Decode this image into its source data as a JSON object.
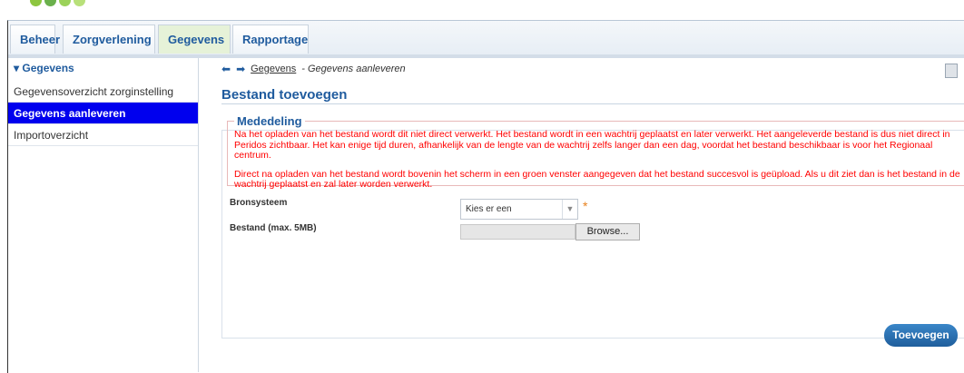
{
  "tabs": [
    {
      "label": "Beheer",
      "active": false
    },
    {
      "label": "Zorgverlening",
      "active": false
    },
    {
      "label": "Gegevens",
      "active": true
    },
    {
      "label": "Rapportage",
      "active": false
    }
  ],
  "sidebar": {
    "header": "Gegevens",
    "header_icon": "triangle-down",
    "items": [
      {
        "label": "Gegevensoverzicht zorginstelling",
        "active": false
      },
      {
        "label": "Gegevens aanleveren",
        "active": true
      },
      {
        "label": "Importoverzicht",
        "active": false
      }
    ]
  },
  "breadcrumb": {
    "link": "Gegevens",
    "current": "- Gegevens aanleveren",
    "icons": [
      "arrow-left-icon",
      "arrow-right-icon"
    ]
  },
  "page": {
    "title": "Bestand toevoegen"
  },
  "notice": {
    "legend": "Mededeling",
    "paragraph1": "Na het opladen van het bestand wordt dit niet direct verwerkt. Het bestand wordt in een wachtrij geplaatst en later verwerkt. Het aangeleverde bestand is dus niet direct in Peridos zichtbaar. Het kan enige tijd duren, afhankelijk van de lengte van de wachtrij zelfs langer dan een dag, voordat het bestand beschikbaar is voor het Regionaal centrum.",
    "paragraph2": "Direct na opladen van het bestand wordt bovenin het scherm in een groen venster aangegeven dat het bestand succesvol is geüpload. Als u dit ziet dan is het bestand in de wachtrij geplaatst en zal later worden verwerkt."
  },
  "form": {
    "bronsysteem_label": "Bronsysteem",
    "bronsysteem_value": "Kies er een",
    "required_mark": "*",
    "bestand_label": "Bestand (max. 5MB)",
    "browse_label": "Browse...",
    "submit_label": "Toevoegen"
  },
  "colors": {
    "accent": "#1f5b9e",
    "active_sidebar": "#0000ee",
    "notice_text": "#ff0000",
    "submit": "#2a74b8"
  }
}
